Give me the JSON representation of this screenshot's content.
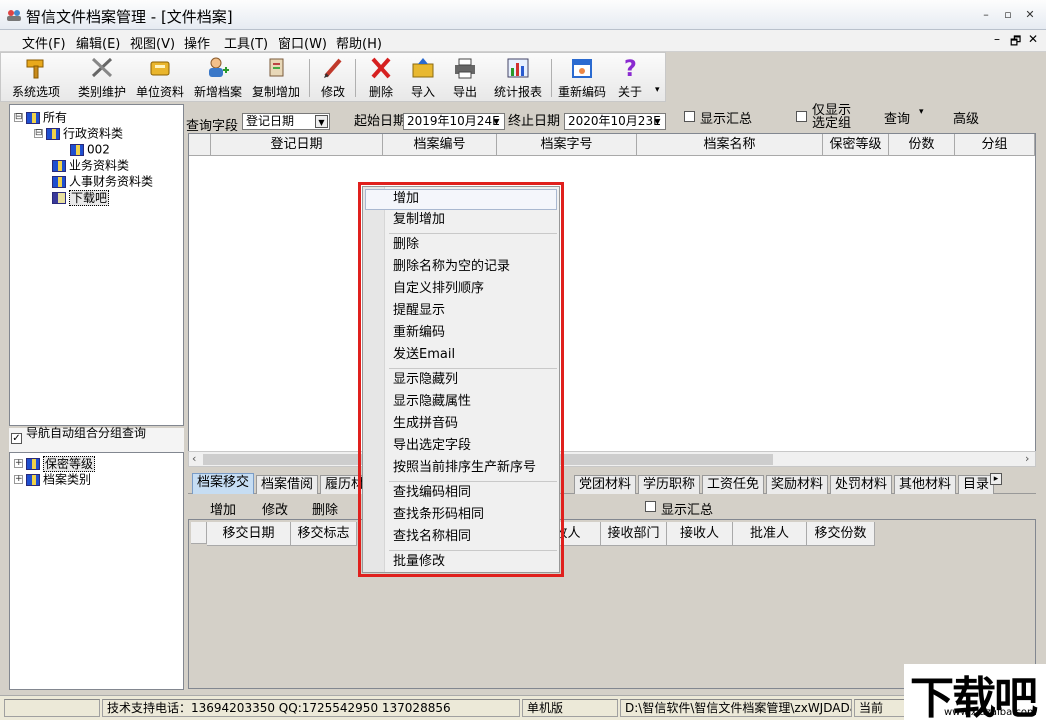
{
  "window": {
    "title": "智信文件档案管理 - [文件档案]",
    "min": "–",
    "restore": "▫",
    "close": "✕"
  },
  "menubar": {
    "items": [
      "文件(F)",
      "编辑(E)",
      "视图(V)",
      "操作",
      "工具(T)",
      "窗口(W)",
      "帮助(H)"
    ],
    "mdi_min": "–",
    "mdi_restore": "🗗",
    "mdi_close": "✕"
  },
  "toolbar": {
    "buttons": [
      {
        "label": "系统选项",
        "icon": "hammer-icon"
      },
      {
        "label": "类别维护",
        "icon": "tools-icon"
      },
      {
        "label": "单位资料",
        "icon": "book-icon"
      },
      {
        "label": "新增档案",
        "icon": "add-user-icon"
      },
      {
        "label": "复制增加",
        "icon": "copy-add-icon"
      },
      {
        "label": "修改",
        "icon": "pencil-icon"
      },
      {
        "label": "删除",
        "icon": "delete-x-icon"
      },
      {
        "label": "导入",
        "icon": "import-folder-icon"
      },
      {
        "label": "导出",
        "icon": "printer-icon"
      },
      {
        "label": "统计报表",
        "icon": "bar-chart-icon"
      },
      {
        "label": "重新编码",
        "icon": "calendar-icon"
      },
      {
        "label": "关于",
        "icon": "question-icon"
      }
    ]
  },
  "tree": {
    "items": [
      {
        "label": "所有",
        "exp": "⊟"
      },
      {
        "label": "行政资料类",
        "exp": "⊟"
      },
      {
        "label": "002",
        "exp": ""
      },
      {
        "label": "业务资料类",
        "exp": ""
      },
      {
        "label": "人事财务资料类",
        "exp": ""
      },
      {
        "label": "下载吧",
        "exp": ""
      }
    ]
  },
  "nav_combo": {
    "checked": "✓",
    "label": "导航自动组合分组查询"
  },
  "group_tree": {
    "items": [
      {
        "label": "保密等级",
        "exp": "+"
      },
      {
        "label": "档案类别",
        "exp": "+"
      }
    ]
  },
  "query": {
    "field_label": "查询字段",
    "field_value": "登记日期",
    "start_label": "起始日期",
    "start_value": "2019年10月24E",
    "end_label": "终止日期",
    "end_value": "2020年10月23E",
    "show_summary": "显示汇总",
    "only_selected": "仅显示选定组",
    "query_btn": "查询",
    "advanced_btn": "高级"
  },
  "grid": {
    "columns": [
      "登记日期",
      "档案编号",
      "档案字号",
      "档案名称",
      "保密等级",
      "份数",
      "分组"
    ]
  },
  "tabs": {
    "items": [
      "档案移交",
      "档案借阅",
      "履历材",
      "",
      "党团材料",
      "学历职称",
      "工资任免",
      "奖励材料",
      "处罚材料",
      "其他材料",
      "目录"
    ],
    "more": "▸"
  },
  "subtoolbar": {
    "add": "增加",
    "edit": "修改",
    "delete": "删除",
    "show_summary": "显示汇总"
  },
  "bottom_grid": {
    "columns": [
      "移交日期",
      "移交标志",
      "",
      "收人",
      "接收部门",
      "接收人",
      "批准人",
      "移交份数"
    ]
  },
  "context_menu": {
    "items": [
      "增加",
      "复制增加",
      "删除",
      "删除名称为空的记录",
      "自定义排列顺序",
      "提醒显示",
      "重新编码",
      "发送Email",
      "显示隐藏列",
      "显示隐藏属性",
      "生成拼音码",
      "导出选定字段",
      "按照当前排序生产新序号",
      "查找编码相同",
      "查找条形码相同",
      "查找名称相同",
      "批量修改"
    ]
  },
  "statusbar": {
    "support": "技术支持电话：13694203350 QQ:1725542950 137028856",
    "edition": "单机版",
    "path": "D:\\智信软件\\智信文件档案管理\\zxWJDAData.sys",
    "current": "当前"
  },
  "watermark": {
    "main": "下载吧",
    "sub": "www.xiazaiba.com"
  }
}
